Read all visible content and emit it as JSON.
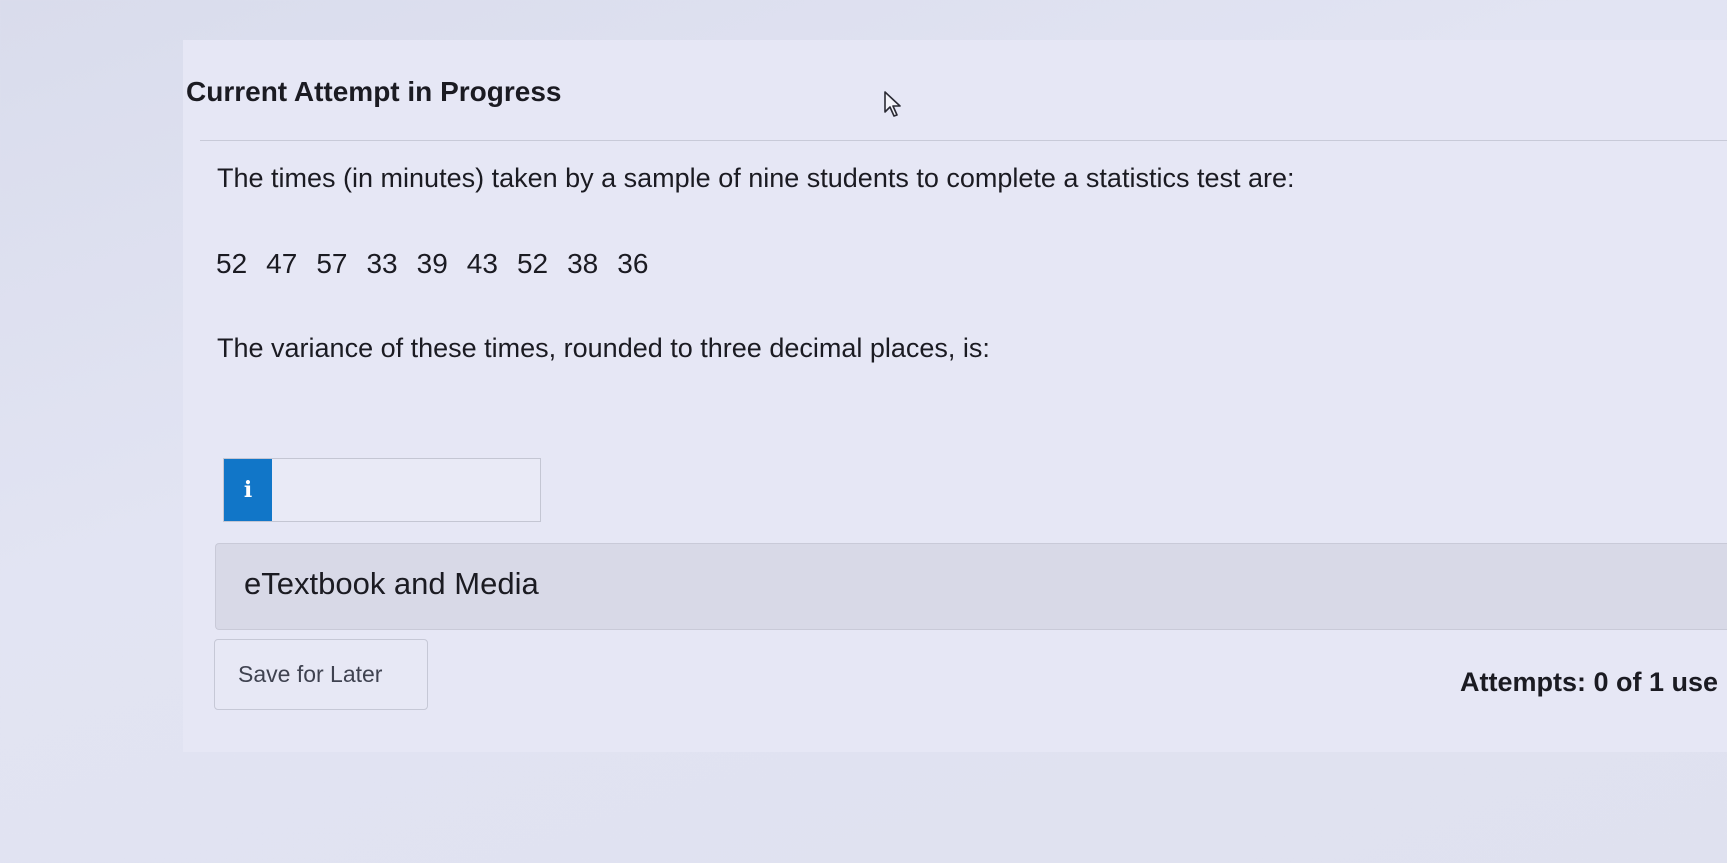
{
  "header": {
    "title": "Current Attempt in Progress"
  },
  "question": {
    "text": "The times (in minutes) taken by a sample of nine students to complete a statistics test are:",
    "values": [
      "52",
      "47",
      "57",
      "33",
      "39",
      "43",
      "52",
      "38",
      "36"
    ],
    "prompt": "The variance of these times, rounded to three decimal places, is:"
  },
  "answer": {
    "info_icon": "i",
    "value": ""
  },
  "media": {
    "label": "eTextbook and Media"
  },
  "footer": {
    "save_label": "Save for Later",
    "attempts_text": "Attempts: 0 of 1 use"
  },
  "colors": {
    "accent": "#1176c8",
    "background": "#e2e4f3"
  }
}
